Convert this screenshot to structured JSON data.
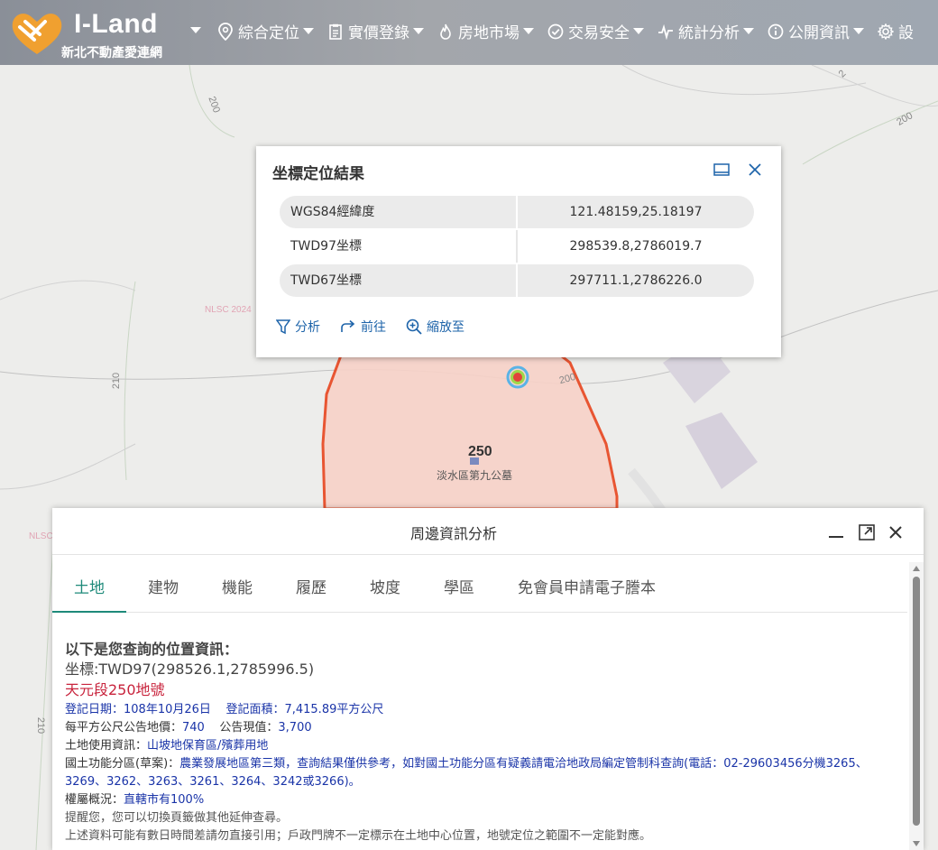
{
  "header": {
    "brand_name": "I-Land",
    "brand_sub": "新北不動產愛連網",
    "nav": [
      {
        "label": "綜合定位",
        "icon": "location-pin-icon"
      },
      {
        "label": "實價登錄",
        "icon": "document-icon"
      },
      {
        "label": "房地市場",
        "icon": "flame-icon"
      },
      {
        "label": "交易安全",
        "icon": "check-circle-icon"
      },
      {
        "label": "統計分析",
        "icon": "pulse-icon"
      },
      {
        "label": "公開資訊",
        "icon": "info-circle-icon"
      },
      {
        "label": "設",
        "icon": "gear-icon"
      }
    ]
  },
  "map": {
    "contours": [
      "200",
      "200",
      "210",
      "210",
      "200",
      "2"
    ],
    "watermark_1": "NLSC 2024",
    "watermark_2": "NLSC",
    "parcel_number": "250",
    "parcel_name": "淡水區第九公墓"
  },
  "popup": {
    "title": "坐標定位結果",
    "rows": [
      {
        "label": "WGS84經緯度",
        "value": "121.48159,25.18197"
      },
      {
        "label": "TWD97坐標",
        "value": "298539.8,2786019.7"
      },
      {
        "label": "TWD67坐標",
        "value": "297711.1,2786226.0"
      }
    ],
    "actions": [
      "分析",
      "前往",
      "縮放至"
    ]
  },
  "panel": {
    "title": "周邊資訊分析",
    "tabs": [
      "土地",
      "建物",
      "機能",
      "履歷",
      "坡度",
      "學區",
      "免會員申請電子謄本"
    ],
    "heading": "以下是您查詢的位置資訊：",
    "coord": "坐標:TWD97(298526.1,2785996.5)",
    "lot": "天元段250地號",
    "reg_date_label": "登記日期：",
    "reg_date": "108年10月26日",
    "reg_area_label": "登記面積：",
    "reg_area": "7,415.89平方公尺",
    "price_label": "每平方公尺公告地價：",
    "price": "740",
    "current_label": "公告現值：",
    "current": "3,700",
    "usage_label": "土地使用資訊：",
    "usage": "山坡地保育區/殯葬用地",
    "zone_label": "國土功能分區(草案)：",
    "zone": "農業發展地區第三類，查詢結果僅供參考，如對國土功能分區有疑義請電洽地政局編定管制科查詢(電話：02-29603456分機3265、3269、3262、3263、3261、3264、3242或3266)。",
    "owner_label": "權屬概況：",
    "owner": "直轄市有100%",
    "note_1": "提醒您，您可以切換頁籤做其他延伸查尋。",
    "note_2": "上述資料可能有數日時間差請勿直接引用；戶政門牌不一定標示在土地中心位置，地號定位之範圍不一定能對應。"
  },
  "colors": {
    "accent_teal": "#1e8a7a",
    "link_blue": "#1a34a8",
    "lot_red": "#c8233c",
    "parcel_outline": "#e8451e",
    "parcel_fill": "#f8d2c8"
  }
}
